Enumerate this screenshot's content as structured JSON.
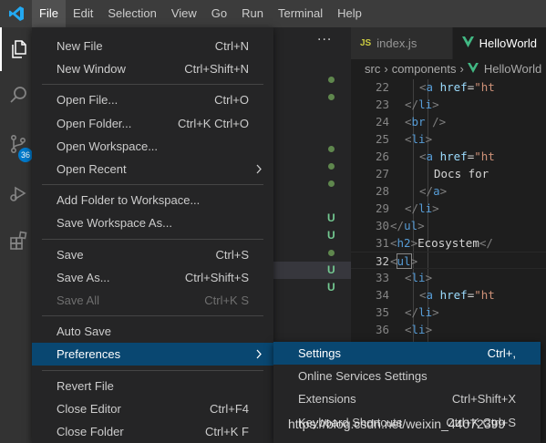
{
  "menubar": {
    "items": [
      "File",
      "Edit",
      "Selection",
      "View",
      "Go",
      "Run",
      "Terminal",
      "Help"
    ]
  },
  "activity": {
    "source_control_badge": "36"
  },
  "git_decorations": [
    "",
    "",
    "dot",
    "dot",
    "",
    "",
    "dot",
    "dot",
    "dot",
    "",
    "U",
    "U",
    "dot",
    "U",
    "U",
    ""
  ],
  "sidebar": {
    "more": "···"
  },
  "tabs": [
    {
      "label": "index.js",
      "icon": "JS"
    },
    {
      "label": "HelloWorld"
    }
  ],
  "breadcrumb": {
    "parts": [
      "src",
      "components",
      "HelloWorld"
    ]
  },
  "code": {
    "lines": [
      {
        "n": "22",
        "indent": 4,
        "tokens": [
          [
            "br",
            "<"
          ],
          [
            "tag",
            "a"
          ],
          [
            "txt",
            " "
          ],
          [
            "attr",
            "href"
          ],
          [
            "txt",
            "="
          ],
          [
            "str",
            "\"ht"
          ]
        ]
      },
      {
        "n": "23",
        "indent": 3,
        "tokens": [
          [
            "br",
            "</"
          ],
          [
            "tag",
            "li"
          ],
          [
            "br",
            ">"
          ]
        ]
      },
      {
        "n": "24",
        "indent": 3,
        "tokens": [
          [
            "br",
            "<"
          ],
          [
            "tag",
            "br"
          ],
          [
            "txt",
            " "
          ],
          [
            "br",
            "/>"
          ]
        ]
      },
      {
        "n": "25",
        "indent": 3,
        "tokens": [
          [
            "br",
            "<"
          ],
          [
            "tag",
            "li"
          ],
          [
            "br",
            ">"
          ]
        ]
      },
      {
        "n": "26",
        "indent": 4,
        "tokens": [
          [
            "br",
            "<"
          ],
          [
            "tag",
            "a"
          ],
          [
            "txt",
            " "
          ],
          [
            "attr",
            "href"
          ],
          [
            "txt",
            "="
          ],
          [
            "str",
            "\"ht"
          ]
        ]
      },
      {
        "n": "27",
        "indent": 5,
        "tokens": [
          [
            "txt",
            "Docs for"
          ]
        ]
      },
      {
        "n": "28",
        "indent": 4,
        "tokens": [
          [
            "br",
            "</"
          ],
          [
            "tag",
            "a"
          ],
          [
            "br",
            ">"
          ]
        ]
      },
      {
        "n": "29",
        "indent": 3,
        "tokens": [
          [
            "br",
            "</"
          ],
          [
            "tag",
            "li"
          ],
          [
            "br",
            ">"
          ]
        ]
      },
      {
        "n": "30",
        "indent": 2,
        "tokens": [
          [
            "br",
            "</"
          ],
          [
            "tag",
            "ul"
          ],
          [
            "br",
            ">"
          ]
        ]
      },
      {
        "n": "31",
        "indent": 2,
        "tokens": [
          [
            "br",
            "<"
          ],
          [
            "tag",
            "h2"
          ],
          [
            "br",
            ">"
          ],
          [
            "txt",
            "Ecosystem"
          ],
          [
            "br",
            "</"
          ]
        ]
      },
      {
        "n": "32",
        "indent": 2,
        "tokens": [
          [
            "br",
            "<"
          ],
          [
            "tag",
            "ul"
          ],
          [
            "br",
            ">"
          ]
        ],
        "current": true
      },
      {
        "n": "33",
        "indent": 3,
        "tokens": [
          [
            "br",
            "<"
          ],
          [
            "tag",
            "li"
          ],
          [
            "br",
            ">"
          ]
        ]
      },
      {
        "n": "34",
        "indent": 4,
        "tokens": [
          [
            "br",
            "<"
          ],
          [
            "tag",
            "a"
          ],
          [
            "txt",
            " "
          ],
          [
            "attr",
            "href"
          ],
          [
            "txt",
            "="
          ],
          [
            "str",
            "\"ht"
          ]
        ]
      },
      {
        "n": "35",
        "indent": 3,
        "tokens": [
          [
            "br",
            "</"
          ],
          [
            "tag",
            "li"
          ],
          [
            "br",
            ">"
          ]
        ]
      },
      {
        "n": "36",
        "indent": 3,
        "tokens": [
          [
            "br",
            "<"
          ],
          [
            "tag",
            "li"
          ],
          [
            "br",
            ">"
          ]
        ]
      }
    ]
  },
  "file_menu": {
    "items": [
      {
        "label": "New File",
        "key": "Ctrl+N"
      },
      {
        "label": "New Window",
        "key": "Ctrl+Shift+N"
      },
      {
        "sep": true
      },
      {
        "label": "Open File...",
        "key": "Ctrl+O"
      },
      {
        "label": "Open Folder...",
        "key": "Ctrl+K Ctrl+O"
      },
      {
        "label": "Open Workspace...",
        "key": ""
      },
      {
        "label": "Open Recent",
        "key": "",
        "submenu": true
      },
      {
        "sep": true
      },
      {
        "label": "Add Folder to Workspace...",
        "key": ""
      },
      {
        "label": "Save Workspace As...",
        "key": ""
      },
      {
        "sep": true
      },
      {
        "label": "Save",
        "key": "Ctrl+S"
      },
      {
        "label": "Save As...",
        "key": "Ctrl+Shift+S"
      },
      {
        "label": "Save All",
        "key": "Ctrl+K S",
        "disabled": true
      },
      {
        "sep": true
      },
      {
        "label": "Auto Save",
        "key": ""
      },
      {
        "label": "Preferences",
        "key": "",
        "submenu": true,
        "selected": true
      },
      {
        "sep": true
      },
      {
        "label": "Revert File",
        "key": ""
      },
      {
        "label": "Close Editor",
        "key": "Ctrl+F4"
      },
      {
        "label": "Close Folder",
        "key": "Ctrl+K F"
      }
    ]
  },
  "preferences_menu": {
    "items": [
      {
        "label": "Settings",
        "key": "Ctrl+,",
        "selected": true
      },
      {
        "label": "Online Services Settings",
        "key": ""
      },
      {
        "label": "Extensions",
        "key": "Ctrl+Shift+X"
      },
      {
        "label": "Keyboard Shortcuts",
        "key": "Ctrl+K Ctrl+S"
      }
    ]
  },
  "watermark": "https://blog.csdn.net/weixin_44072399",
  "colors": {
    "accent": "#007acc",
    "selection": "#094771",
    "menubar": "#3c3c3c"
  }
}
